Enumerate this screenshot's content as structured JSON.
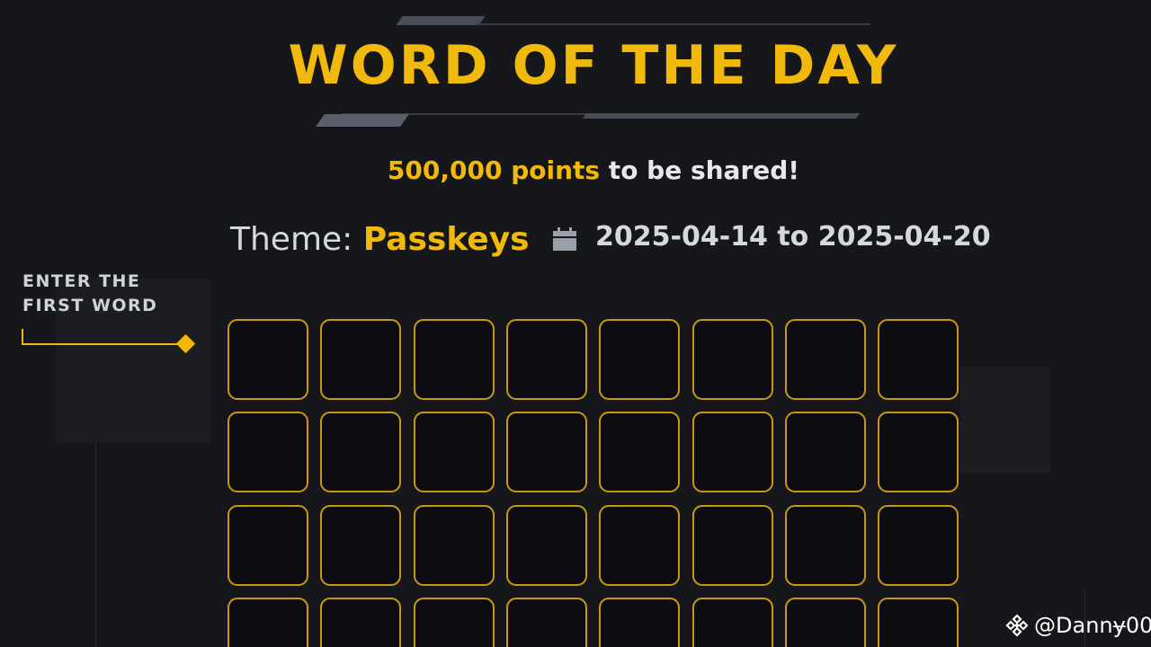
{
  "title": "WORD OF THE DAY",
  "prize": {
    "highlight": "500,000 points",
    "rest": " to be shared!"
  },
  "theme": {
    "label": "Theme: ",
    "value": "Passkeys"
  },
  "dates": {
    "icon": "calendar-icon",
    "range": "2025-04-14 to 2025-04-20"
  },
  "prompt": {
    "line1": "ENTER THE",
    "line2": "FIRST WORD"
  },
  "grid": {
    "columns": 8,
    "rows_visible": 4,
    "letters": [
      [
        "",
        "",
        "",
        "",
        "",
        "",
        "",
        ""
      ],
      [
        "",
        "",
        "",
        "",
        "",
        "",
        "",
        ""
      ],
      [
        "",
        "",
        "",
        "",
        "",
        "",
        "",
        ""
      ],
      [
        "",
        "",
        "",
        "",
        "",
        "",
        "",
        ""
      ]
    ]
  },
  "watermark": {
    "icon": "binance-logo-icon",
    "text": "@Dannɏ00"
  },
  "colors": {
    "accent": "#f0b90b",
    "cell_border": "#c99712",
    "background": "#16171b",
    "cell_fill": "#0b0d10"
  }
}
